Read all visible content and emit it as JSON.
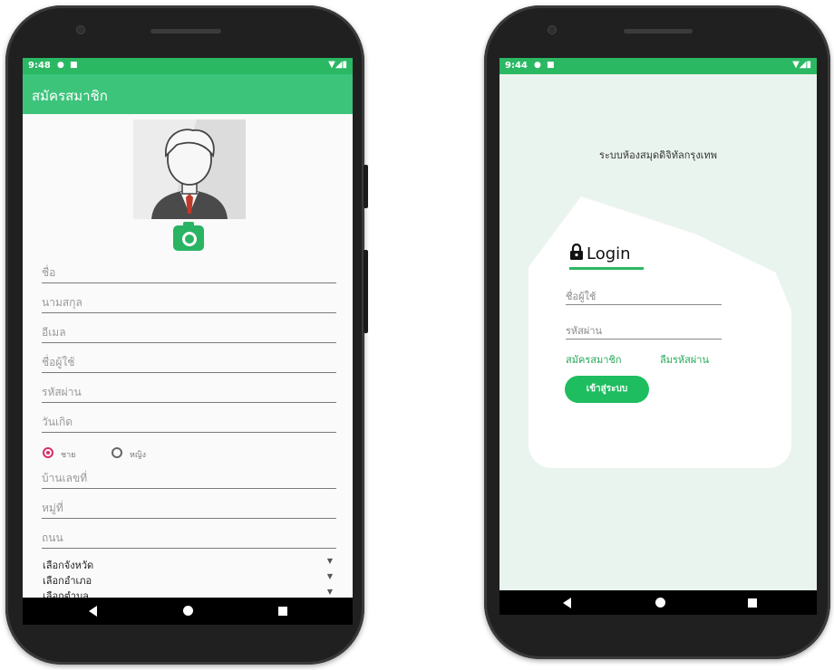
{
  "register": {
    "status_time": "9:48",
    "title": "สมัครสมาชิก",
    "fields": [
      "ชื่อ",
      "นามสกุล",
      "อีเมล",
      "ชื่อผู้ใช้",
      "รหัสผ่าน",
      "วันเกิด",
      "บ้านเลขที่",
      "หมู่ที่",
      "ถนน"
    ],
    "gender": {
      "male": "ชาย",
      "female": "หญิง",
      "selected": "male"
    },
    "dropdowns": [
      "เลือกจังหวัด",
      "เลือกอำเภอ",
      "เลือกตำบล"
    ],
    "icons": {
      "avatar": "person-avatar-icon",
      "camera": "camera-icon"
    }
  },
  "login": {
    "status_time": "9:44",
    "library_name": "ระบบห้องสมุดดิจิทัลกรุงเทพ",
    "heading": "Login",
    "username_placeholder": "ชื่อผู้ใช้",
    "password_placeholder": "รหัสผ่าน",
    "register_link": "สมัครสมาชิก",
    "forgot_link": "ลืมรหัสผ่าน",
    "submit": "เข้าสู่ระบบ",
    "icons": {
      "lock": "lock-icon"
    }
  },
  "colors": {
    "status_bar": "#2bb863",
    "app_bar": "#3cc47b",
    "accent_green": "#1ebd5f",
    "radio_selected": "#d62f6a",
    "login_bg": "#eaf4ee"
  }
}
